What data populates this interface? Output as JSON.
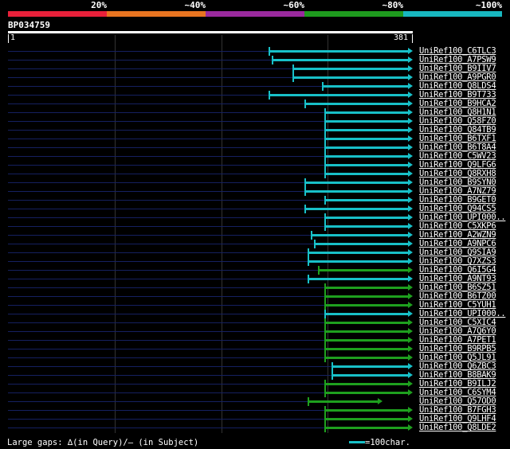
{
  "scale": {
    "labels": [
      "20%",
      "~40%",
      "~60%",
      "~80%",
      "~100%"
    ],
    "colors": [
      "#e8203a",
      "#e87420",
      "#9a2a9e",
      "#1e9a1e",
      "#18b8c0"
    ]
  },
  "query": {
    "title": "BP034759",
    "start": "1",
    "end": "381"
  },
  "hit_colors": {
    "cyan": "#18c0c8",
    "green": "#1ea01e"
  },
  "hits": [
    {
      "id": "UniRef100_C6TLC3",
      "start": 248,
      "end": 381,
      "color": "cyan"
    },
    {
      "id": "UniRef100_A7PSW9",
      "start": 251,
      "end": 381,
      "color": "cyan"
    },
    {
      "id": "UniRef100_B9IIV7",
      "start": 271,
      "end": 381,
      "color": "cyan"
    },
    {
      "id": "UniRef100_A9PGR0",
      "start": 271,
      "end": 381,
      "color": "cyan"
    },
    {
      "id": "UniRef100_Q8LDS4",
      "start": 299,
      "end": 381,
      "color": "cyan"
    },
    {
      "id": "UniRef100_B9T733",
      "start": 248,
      "end": 381,
      "color": "cyan"
    },
    {
      "id": "UniRef100_B9HCA2",
      "start": 282,
      "end": 381,
      "color": "cyan"
    },
    {
      "id": "UniRef100_Q8H1N1",
      "start": 301,
      "end": 381,
      "color": "cyan"
    },
    {
      "id": "UniRef100_Q58FZ0",
      "start": 301,
      "end": 381,
      "color": "cyan"
    },
    {
      "id": "UniRef100_Q84TB9",
      "start": 301,
      "end": 381,
      "color": "cyan"
    },
    {
      "id": "UniRef100_B6TXF1",
      "start": 301,
      "end": 381,
      "color": "cyan"
    },
    {
      "id": "UniRef100_B6T8A4",
      "start": 301,
      "end": 381,
      "color": "cyan"
    },
    {
      "id": "UniRef100_C5WV23",
      "start": 301,
      "end": 381,
      "color": "cyan"
    },
    {
      "id": "UniRef100_Q9LFG6",
      "start": 301,
      "end": 381,
      "color": "cyan"
    },
    {
      "id": "UniRef100_Q8RXH8",
      "start": 301,
      "end": 381,
      "color": "cyan"
    },
    {
      "id": "UniRef100_B9SYN0",
      "start": 282,
      "end": 381,
      "color": "cyan"
    },
    {
      "id": "UniRef100_A7NZ79",
      "start": 282,
      "end": 381,
      "color": "cyan"
    },
    {
      "id": "UniRef100_B9GET0",
      "start": 301,
      "end": 381,
      "color": "cyan"
    },
    {
      "id": "UniRef100_Q94CS5",
      "start": 282,
      "end": 381,
      "color": "cyan"
    },
    {
      "id": "UniRef100_UPI000..",
      "start": 301,
      "end": 381,
      "color": "cyan"
    },
    {
      "id": "UniRef100_C5XKP6",
      "start": 301,
      "end": 381,
      "color": "cyan"
    },
    {
      "id": "UniRef100_A2WZN9",
      "start": 288,
      "end": 381,
      "color": "cyan"
    },
    {
      "id": "UniRef100_A9NPC6",
      "start": 291,
      "end": 381,
      "color": "cyan"
    },
    {
      "id": "UniRef100_Q9SIA9",
      "start": 285,
      "end": 381,
      "color": "cyan"
    },
    {
      "id": "UniRef100_Q7XZS3",
      "start": 285,
      "end": 381,
      "color": "cyan"
    },
    {
      "id": "UniRef100_Q6I5G4",
      "start": 295,
      "end": 381,
      "color": "green"
    },
    {
      "id": "UniRef100_A9NT93",
      "start": 285,
      "end": 381,
      "color": "cyan"
    },
    {
      "id": "UniRef100_B6SZ51",
      "start": 301,
      "end": 381,
      "color": "green"
    },
    {
      "id": "UniRef100_B6TZ00",
      "start": 301,
      "end": 381,
      "color": "green"
    },
    {
      "id": "UniRef100_C5YUH1",
      "start": 301,
      "end": 381,
      "color": "green"
    },
    {
      "id": "UniRef100_UPI000..",
      "start": 301,
      "end": 381,
      "color": "cyan"
    },
    {
      "id": "UniRef100_C5XIC4",
      "start": 301,
      "end": 381,
      "color": "green"
    },
    {
      "id": "UniRef100_A7Q6Y0",
      "start": 301,
      "end": 381,
      "color": "green"
    },
    {
      "id": "UniRef100_A7PET1",
      "start": 301,
      "end": 381,
      "color": "green"
    },
    {
      "id": "UniRef100_B9RPB5",
      "start": 301,
      "end": 381,
      "color": "green"
    },
    {
      "id": "UniRef100_Q5JL91",
      "start": 301,
      "end": 381,
      "color": "green"
    },
    {
      "id": "UniRef100_Q6ZBC3",
      "start": 308,
      "end": 381,
      "color": "cyan"
    },
    {
      "id": "UniRef100_B8BAK9",
      "start": 308,
      "end": 381,
      "color": "cyan"
    },
    {
      "id": "UniRef100_B9ILJ2",
      "start": 301,
      "end": 381,
      "color": "green"
    },
    {
      "id": "UniRef100_C6SYM4",
      "start": 301,
      "end": 381,
      "color": "green"
    },
    {
      "id": "UniRef100_Q57OD0",
      "start": 285,
      "end": 352,
      "color": "green"
    },
    {
      "id": "UniRef100_B7FGH3",
      "start": 301,
      "end": 381,
      "color": "green"
    },
    {
      "id": "UniRef100_Q9LHF4",
      "start": 301,
      "end": 381,
      "color": "green"
    },
    {
      "id": "UniRef100_Q8LDE2",
      "start": 301,
      "end": 381,
      "color": "green"
    }
  ],
  "legend": {
    "gaps_text": "Large gaps: ∆(in Query)/– (in Subject)",
    "bar_text": "=100char."
  }
}
